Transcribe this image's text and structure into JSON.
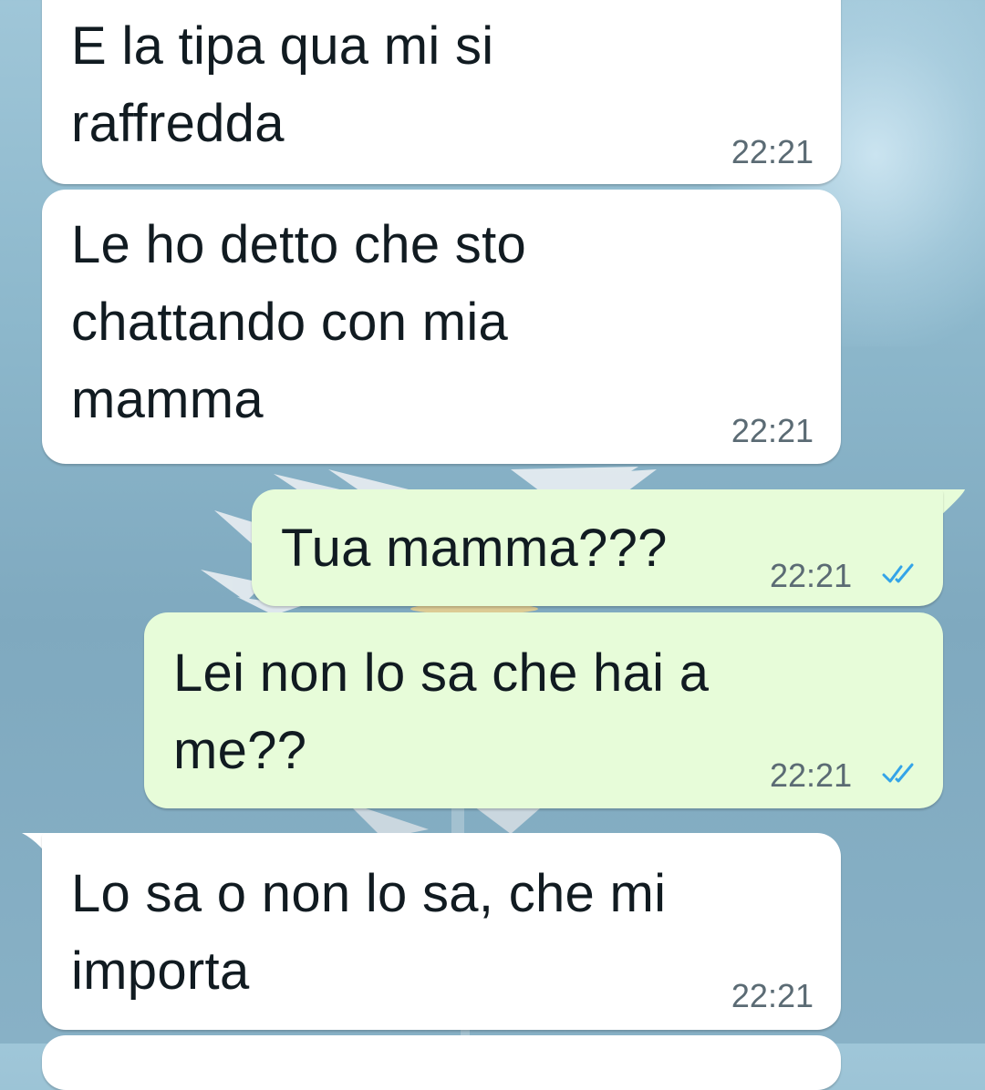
{
  "messages": [
    {
      "direction": "incoming",
      "text": [
        "E la tipa qua mi si",
        "raffredda"
      ],
      "time": "22:21"
    },
    {
      "direction": "incoming",
      "text": [
        "Le ho detto che sto",
        "chattando con mia",
        "mamma"
      ],
      "time": "22:21"
    },
    {
      "direction": "outgoing",
      "text": [
        "Tua mamma???"
      ],
      "time": "22:21",
      "status": "read"
    },
    {
      "direction": "outgoing",
      "text": [
        "Lei non lo sa che hai a",
        "me??"
      ],
      "time": "22:21",
      "status": "read"
    },
    {
      "direction": "incoming",
      "text": [
        "Lo sa o non lo sa, che mi",
        "importa"
      ],
      "time": "22:21"
    }
  ],
  "colors": {
    "incoming_bubble": "#ffffff",
    "outgoing_bubble": "#e7fcd9",
    "read_tick": "#34a4e8",
    "time_text": "#5b6b74",
    "wallpaper": "#8db8cc"
  },
  "icons": {
    "read_status": "double-check-icon"
  }
}
